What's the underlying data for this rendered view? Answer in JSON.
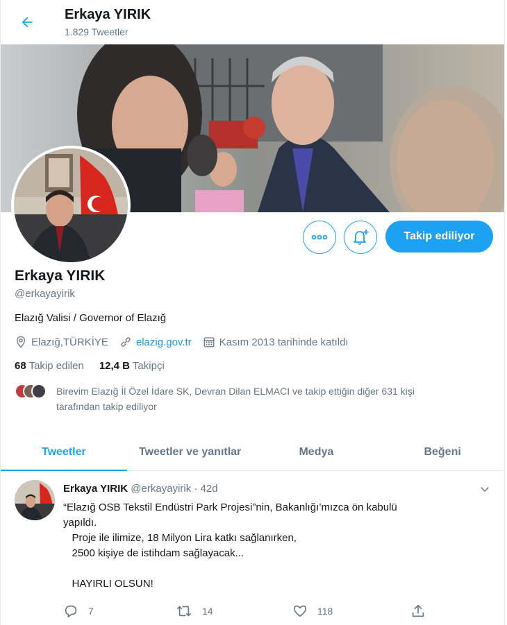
{
  "header": {
    "name": "Erkaya YIRIK",
    "tweet_count": "1.829 Tweetler",
    "icons": {
      "back": "arrow-left-icon"
    }
  },
  "profile": {
    "name": "Erkaya YIRIK",
    "handle": "@erkayayirik",
    "bio": "Elazığ Valisi / Governor of Elazığ",
    "location": "Elazığ,TÜRKİYE",
    "website": "elazig.gov.tr",
    "joined": "Kasım 2013 tarihinde katıldı",
    "following_count": "68",
    "following_label": "Takip edilen",
    "followers_count": "12,4 B",
    "followers_label": "Takipçi",
    "followed_by_text": "Birevim Elazığ İl Özel İdare SK, Devran Dilan ELMACI ve takip ettiğin diğer 631 kişi tarafından takip ediliyor"
  },
  "actions": {
    "follow_label": "Takip ediliyor",
    "icons": {
      "more": "more-icon",
      "notify": "bell-plus-icon"
    }
  },
  "tabs": [
    {
      "label": "Tweetler",
      "active": true
    },
    {
      "label": "Tweetler ve yanıtlar",
      "active": false
    },
    {
      "label": "Medya",
      "active": false
    },
    {
      "label": "Beğeni",
      "active": false
    }
  ],
  "tweet": {
    "name": "Erkaya YIRIK",
    "handle": "@erkayayirik",
    "time": "· 42d",
    "lines": [
      "“Elazığ OSB Tekstil Endüstri Park Projesi”nin, Bakanlığı’mızca ön kabulü",
      "yapıldı.",
      "   Proje ile ilimize, 18 Milyon Lira katkı sağlanırken,",
      "   2500 kişiye de istihdam sağlayacak...",
      "",
      "   HAYIRLI OLSUN!"
    ],
    "replies": "7",
    "retweets": "14",
    "likes": "118"
  },
  "colors": {
    "accent": "#1da1f2",
    "text": "#14171a",
    "secondary": "#657786",
    "link": "#1b95e0"
  }
}
